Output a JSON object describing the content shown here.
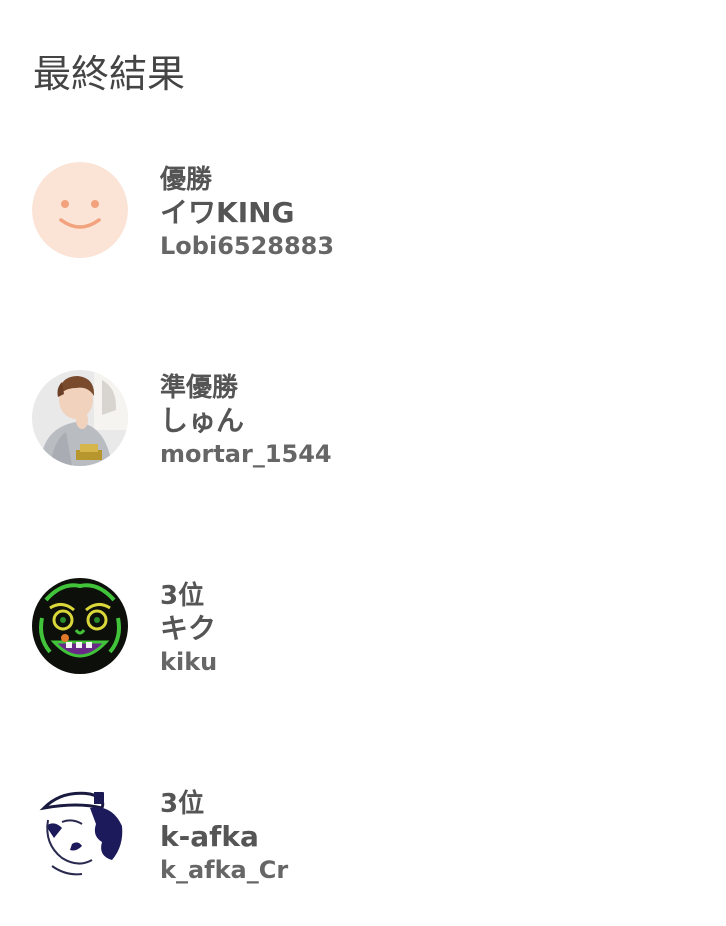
{
  "title": "最終結果",
  "results": [
    {
      "rank": "優勝",
      "name": "イワKING",
      "user_id": "Lobi6528883",
      "avatar": "default-smiley-avatar"
    },
    {
      "rank": "準優勝",
      "name": "しゅん",
      "user_id": "mortar_1544",
      "avatar": "photo-person-avatar"
    },
    {
      "rank": "3位",
      "name": "キク",
      "user_id": "kiku",
      "avatar": "neon-oni-mask-avatar"
    },
    {
      "rank": "3位",
      "name": "k-afka",
      "user_id": "k_afka_Cr",
      "avatar": "sketch-figure-avatar"
    }
  ],
  "colors": {
    "default_avatar_bg": "#FBE3D6",
    "default_avatar_face": "#F2A37E",
    "text": "#555555"
  }
}
